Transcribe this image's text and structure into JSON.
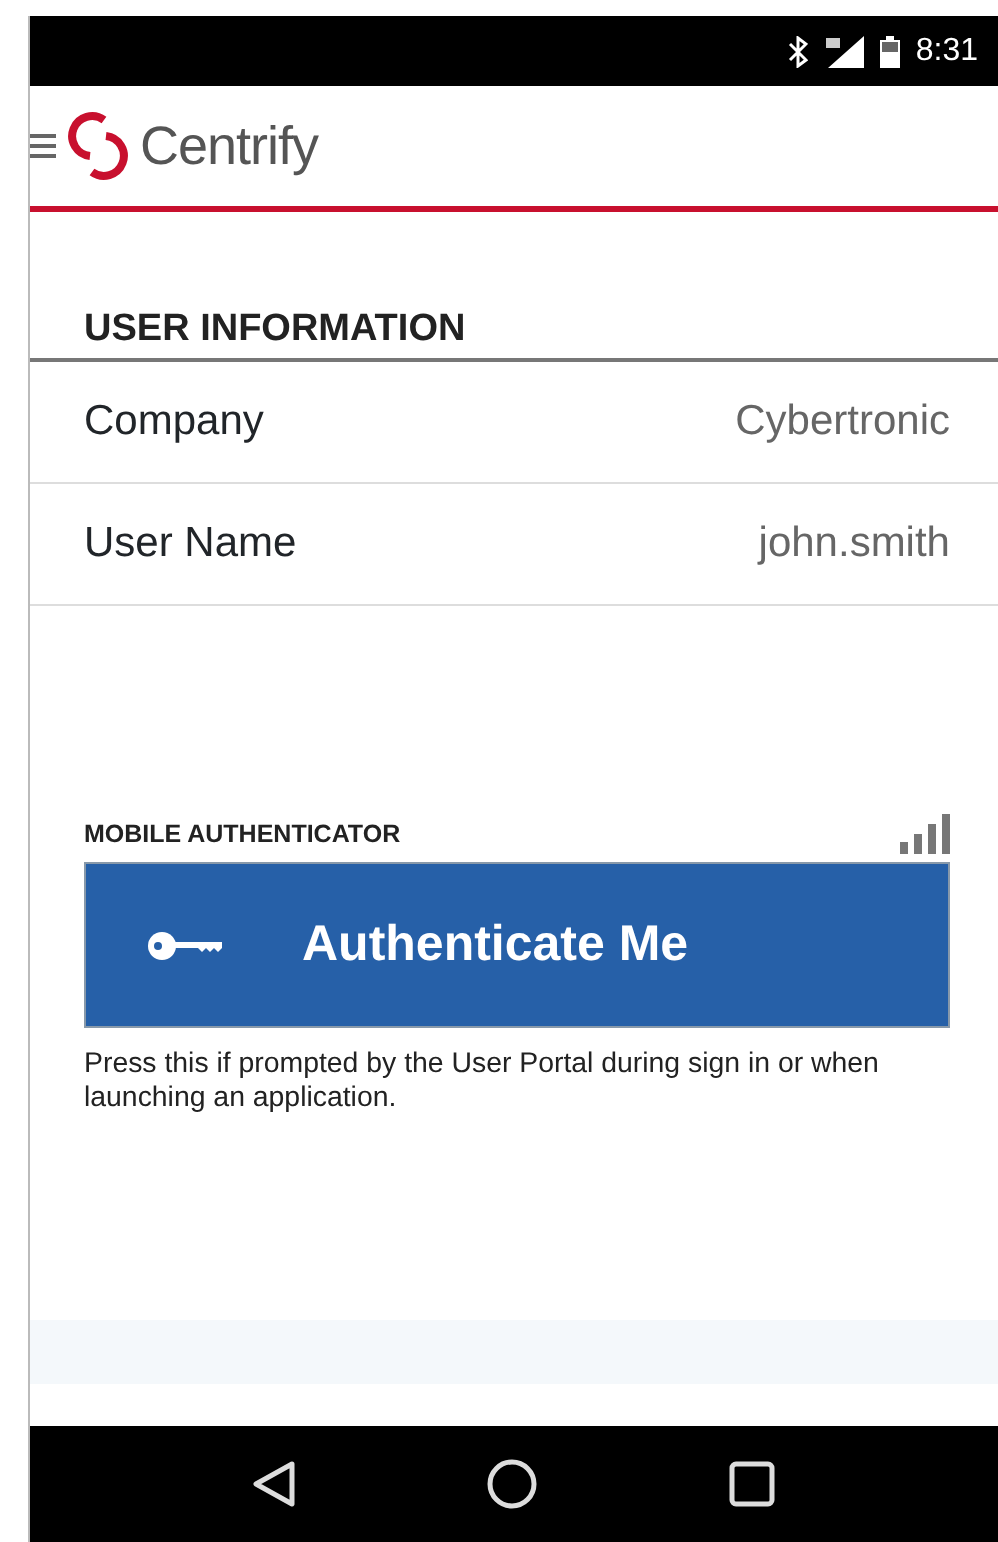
{
  "status_bar": {
    "time": "8:31"
  },
  "header": {
    "brand": "Centrify"
  },
  "user_information": {
    "title": "USER INFORMATION",
    "rows": [
      {
        "label": "Company",
        "value": "Cybertronic"
      },
      {
        "label": "User Name",
        "value": "john.smith"
      }
    ]
  },
  "mobile_authenticator": {
    "title": "MOBILE AUTHENTICATOR",
    "button": "Authenticate Me",
    "hint": "Press this if prompted by the User Portal during sign in or when launching an application."
  }
}
